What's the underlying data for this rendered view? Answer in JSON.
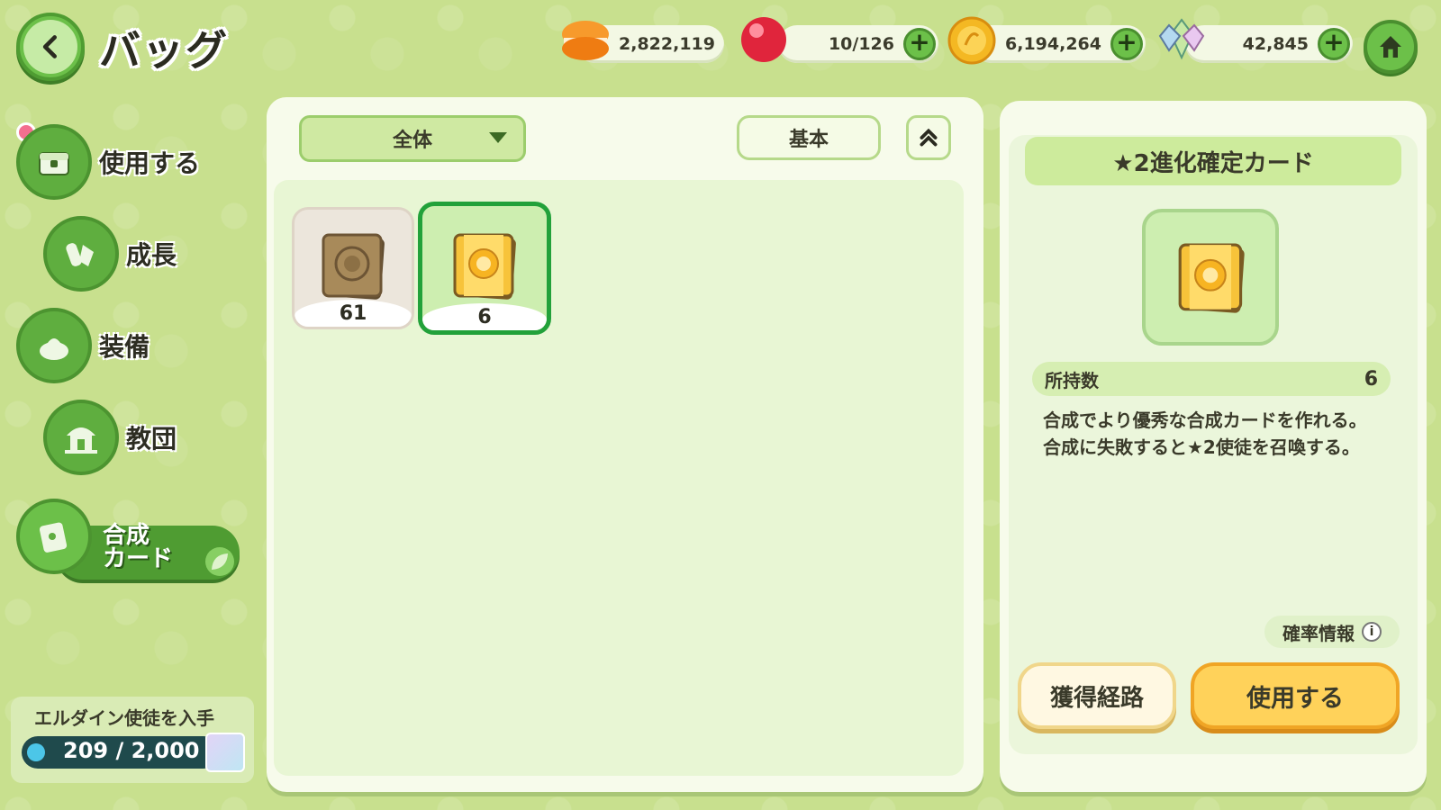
{
  "header": {
    "title": "バッグ"
  },
  "currencies": [
    {
      "name": "macaron",
      "value": "2,822,119",
      "color": "#f28a1a"
    },
    {
      "name": "ruby",
      "value": "10/126",
      "color": "#e0253c"
    },
    {
      "name": "gold-coin",
      "value": "6,194,264",
      "color": "#f4b823"
    },
    {
      "name": "crystal",
      "value": "42,845",
      "color": "#8fd0c8"
    }
  ],
  "sidebar": {
    "items": [
      {
        "label": "使用する",
        "icon": "chest-icon"
      },
      {
        "label": "成長",
        "icon": "potion-icon"
      },
      {
        "label": "装備",
        "icon": "equipment-icon"
      },
      {
        "label": "教団",
        "icon": "temple-icon"
      },
      {
        "label": "合成\nカード",
        "icon": "card-icon",
        "active": true
      }
    ],
    "event": {
      "title": "エルダイン使徒を入手",
      "progress": "209 / 2,000"
    }
  },
  "main": {
    "filter": "全体",
    "sort": "基本",
    "items": [
      {
        "name": "bronze-card",
        "count": "61"
      },
      {
        "name": "gold-card",
        "count": "6",
        "selected": true
      }
    ]
  },
  "detail": {
    "title": "★2進化確定カード",
    "owned_label": "所持数",
    "owned_count": "6",
    "description": "合成でより優秀な合成カードを作れる。\n合成に失敗すると★2使徒を召喚する。",
    "prob_label": "確率情報",
    "acquire_label": "獲得経路",
    "use_label": "使用する"
  },
  "colors": {
    "background": "#c8e08e",
    "accent_green": "#6cc049",
    "selected_border": "#22a13a",
    "primary_button": "#ffd25a"
  }
}
